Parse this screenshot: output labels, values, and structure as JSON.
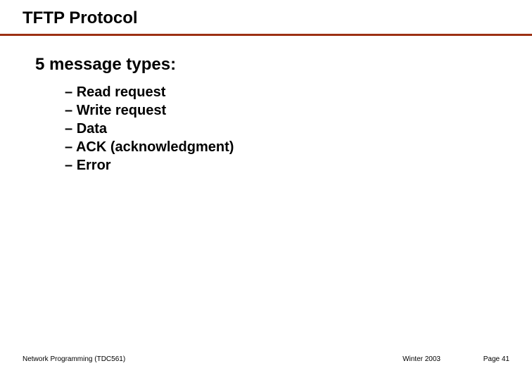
{
  "title": "TFTP Protocol",
  "heading": "5 message types:",
  "items": [
    "Read request",
    "Write request",
    "Data",
    "ACK (acknowledgment)",
    "Error"
  ],
  "footer": {
    "left": "Network Programming (TDC561)",
    "mid": "Winter  2003",
    "right": "Page 41"
  }
}
